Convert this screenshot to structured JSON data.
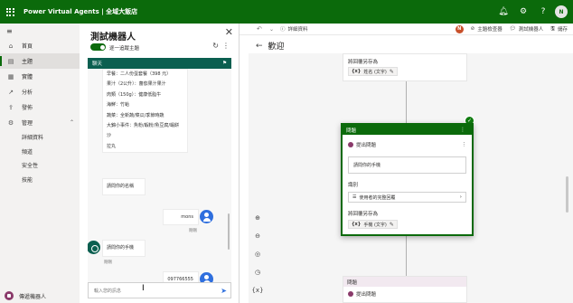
{
  "app": {
    "title": "Power Virtual Agents | 全域大飯店",
    "user_initial": "N",
    "icons": [
      "bell-icon",
      "gear-icon",
      "help-icon"
    ]
  },
  "nav": {
    "items": [
      {
        "label": "首頁",
        "icon": "home-icon"
      },
      {
        "label": "主題",
        "icon": "topics-icon",
        "active": true
      },
      {
        "label": "實體",
        "icon": "entities-icon"
      },
      {
        "label": "分析",
        "icon": "analytics-icon"
      },
      {
        "label": "發佈",
        "icon": "publish-icon"
      },
      {
        "label": "管理",
        "icon": "manage-icon",
        "expanded": true
      }
    ],
    "subitems": [
      "詳細資料",
      "頻道",
      "安全性",
      "技能"
    ],
    "bot_name": "傳遞機器人"
  },
  "test_panel": {
    "title": "測試機器人",
    "toggle_label": "逐一追蹤主題",
    "chat_header": "聊天",
    "menu_block": [
      "早餐：二人份蛋套餐（398 元）",
      "果汁（2公升）：蕃茄果汁果汁",
      "肉類（150g）：健康低脂牛",
      "海鮮：竹蛤",
      "蔬菜：全新蔬/菜瓜/季節時蔬",
      "大錦小事件：魚粉/蝦粉/魚豆腐/蝦餅沙",
      "拉丸"
    ],
    "messages": [
      {
        "from": "bot",
        "text": "請問你的名稱"
      },
      {
        "from": "user",
        "text": "mons",
        "time": "剛剛"
      },
      {
        "from": "bot",
        "text": "請問你的手機",
        "time": "剛剛"
      },
      {
        "from": "user",
        "text": "097766555",
        "time": "剛剛"
      }
    ],
    "input_placeholder": "輸入您的訊息"
  },
  "toolbar": {
    "details": "詳細資料",
    "topic_checker": "主題檢查器",
    "test_bot": "測試機器人",
    "save": "儲存"
  },
  "canvas": {
    "breadcrumb_title": "歡迎",
    "top_card": {
      "save_as": "將回覆另存為",
      "var": "姓名 (文字)"
    },
    "question_card": {
      "header": "問題",
      "ask": "提出問題",
      "question_text": "請問你的手機",
      "identify_label": "識別",
      "identify_value": "使用者的完整回覆",
      "save_as": "將回覆另存為",
      "var": "手機 (文字)"
    },
    "bottom_card": {
      "header": "問題",
      "ask": "提出問題"
    }
  }
}
